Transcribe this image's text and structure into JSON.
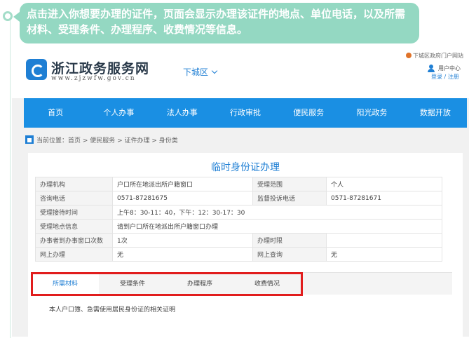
{
  "callout": {
    "text": "点击进入你想要办理的证件，页面会显示办理该证件的地点、单位电话，以及所需材料、受理条件、办理程序、收费情况等信息。"
  },
  "header": {
    "title": "浙江政务服务网",
    "url": "www.zjzwfw.gov.cn",
    "region": "下城区",
    "portal_link": "下城区政府门户网站",
    "user_center": "用户中心",
    "login": "登录",
    "register": "注册",
    "link_separator": "/"
  },
  "nav": {
    "items": [
      "首页",
      "个人办事",
      "法人办事",
      "行政审批",
      "便民服务",
      "阳光政务",
      "数据开放"
    ]
  },
  "breadcrumb": {
    "text": "当前位置：首页 > 便民服务 > 证件办理 > 身份类"
  },
  "panel": {
    "title": "临时身份证办理",
    "rows": [
      {
        "label": "办理机构",
        "value": "户口所在地派出所户籍窗口",
        "label2": "受理范围",
        "value2": "个人"
      },
      {
        "label": "咨询电话",
        "value": "0571-87281675",
        "label2": "监督投诉电话",
        "value2": "0571-87281671"
      },
      {
        "label": "受理接待时间",
        "value": "上午8：30-11：40，下午：12：30-17：30"
      },
      {
        "label": "受理地点信息",
        "value": "请到户口所在地派出所户籍窗口办理"
      },
      {
        "label": "办事者到办事窗口次数",
        "value": "1次",
        "label2": "办理时限",
        "value2": ""
      },
      {
        "label": "网上办理",
        "value": "无",
        "label2": "网上查询",
        "value2": "无"
      }
    ],
    "tabs": [
      "所需材料",
      "受理条件",
      "办理程序",
      "收费情况"
    ],
    "active_tab": "所需材料",
    "material_text": "本人户口簿、急需使用居民身份证的相关证明"
  },
  "colors": {
    "accent": "#1a8fe3",
    "callout": "#94d8c2",
    "highlight": "#e11d1d"
  }
}
